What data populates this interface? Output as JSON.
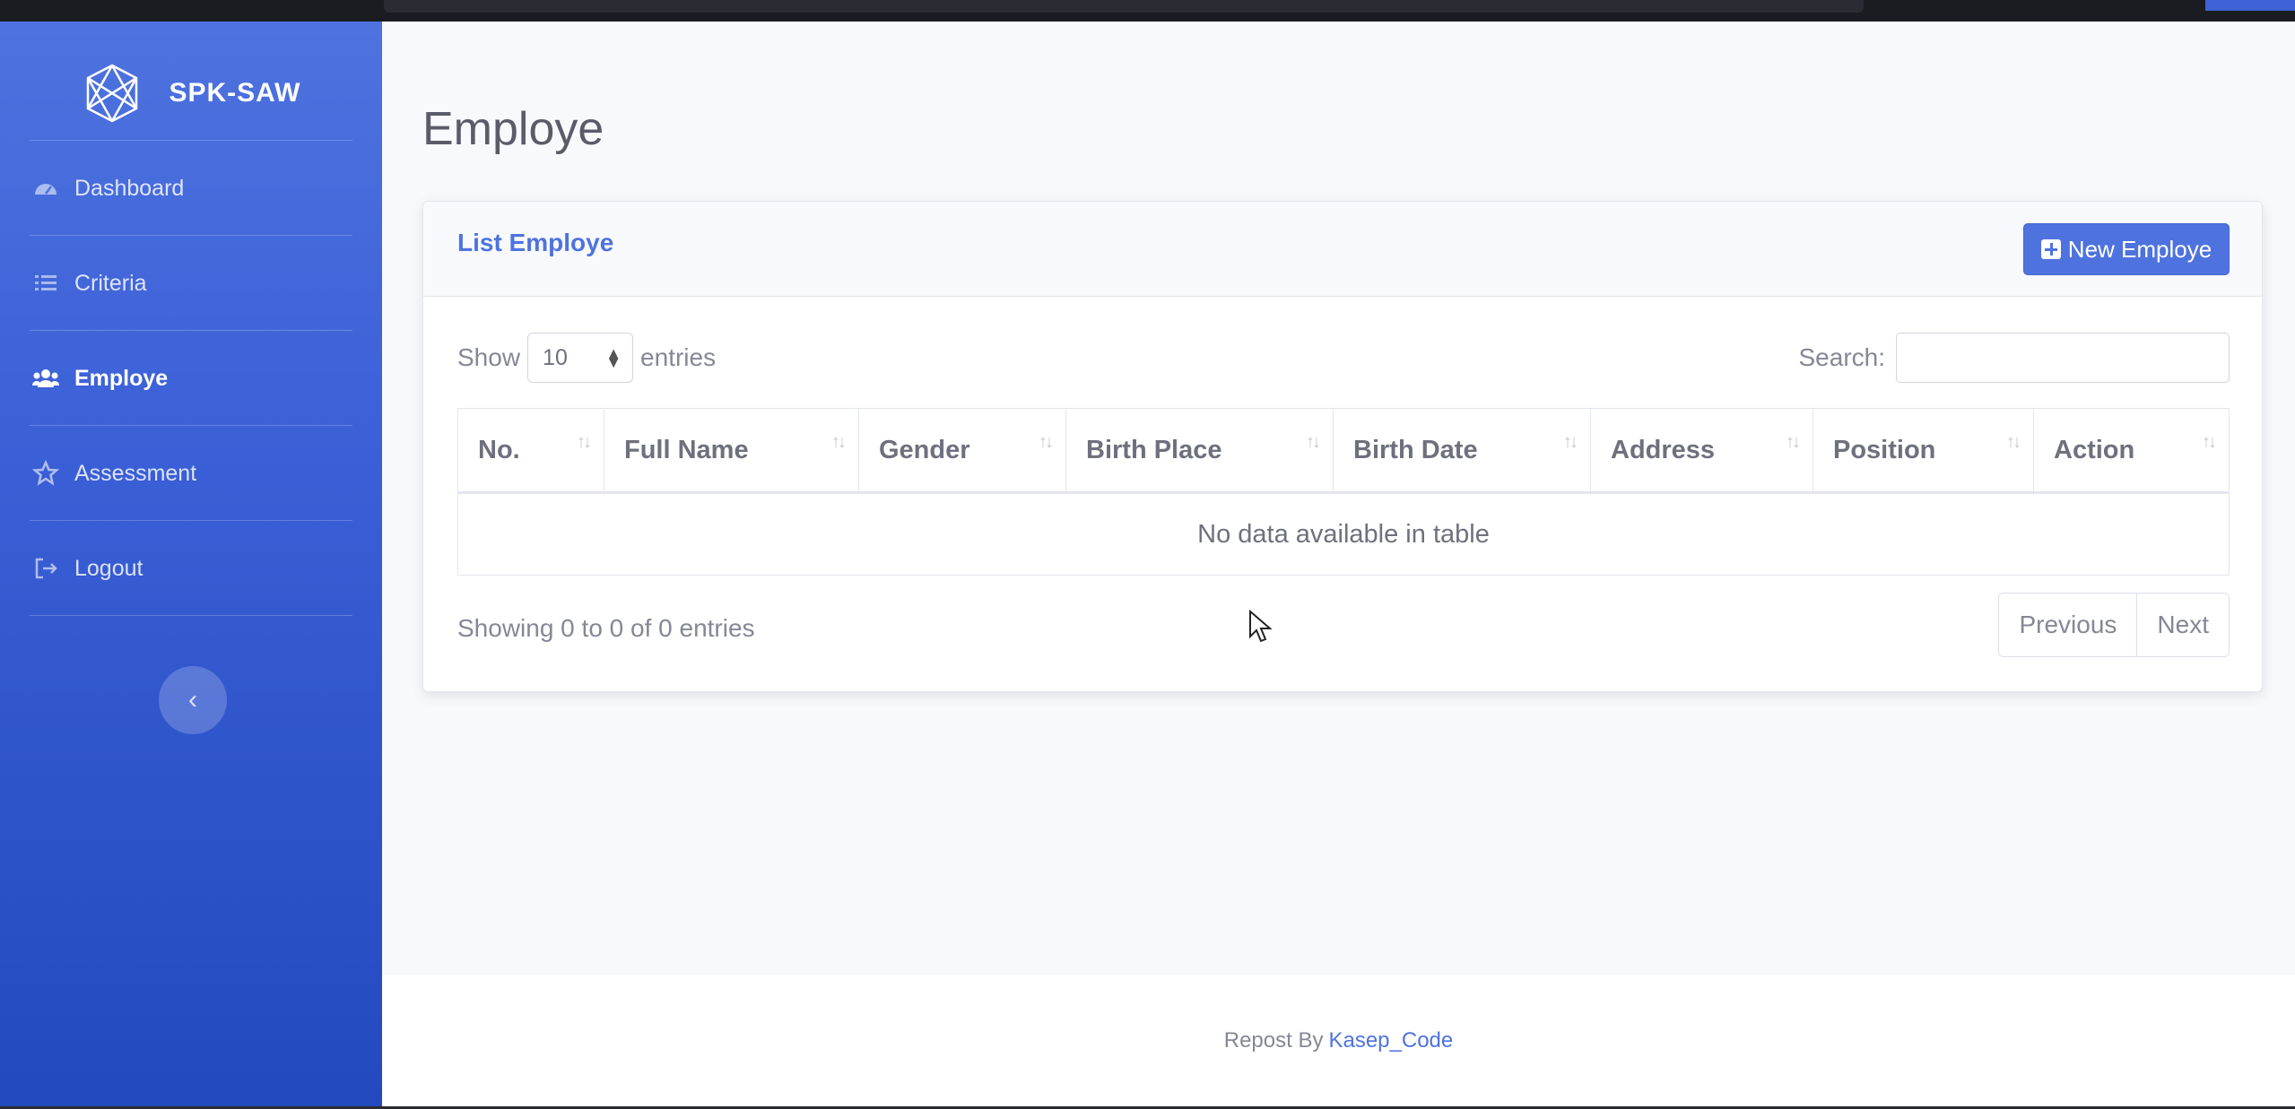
{
  "brand": {
    "title": "SPK-SAW"
  },
  "sidebar": {
    "items": [
      {
        "label": "Dashboard",
        "icon": "tachometer-icon"
      },
      {
        "label": "Criteria",
        "icon": "list-icon"
      },
      {
        "label": "Employe",
        "icon": "users-icon"
      },
      {
        "label": "Assessment",
        "icon": "star-icon"
      },
      {
        "label": "Logout",
        "icon": "sign-out-icon"
      }
    ],
    "active": "Employe",
    "toggle_icon": "chevron-left-icon"
  },
  "main": {
    "page_title": "Employe",
    "card": {
      "title": "List Employe",
      "new_button_label": "New Employe",
      "show_label": "Show",
      "entries_label": "entries",
      "page_length": "10",
      "search_label": "Search:",
      "search_value": "",
      "columns": [
        "No.",
        "Full Name",
        "Gender",
        "Birth Place",
        "Birth Date",
        "Address",
        "Position",
        "Action"
      ],
      "empty_message": "No data available in table",
      "info": "Showing 0 to 0 of 0 entries",
      "pager": {
        "previous": "Previous",
        "next": "Next"
      }
    }
  },
  "footer": {
    "text": "Repost By",
    "link": "Kasep_Code"
  },
  "colors": {
    "primary": "#4e73df",
    "sidebar_dark": "#224abe",
    "text_muted": "#858796"
  }
}
